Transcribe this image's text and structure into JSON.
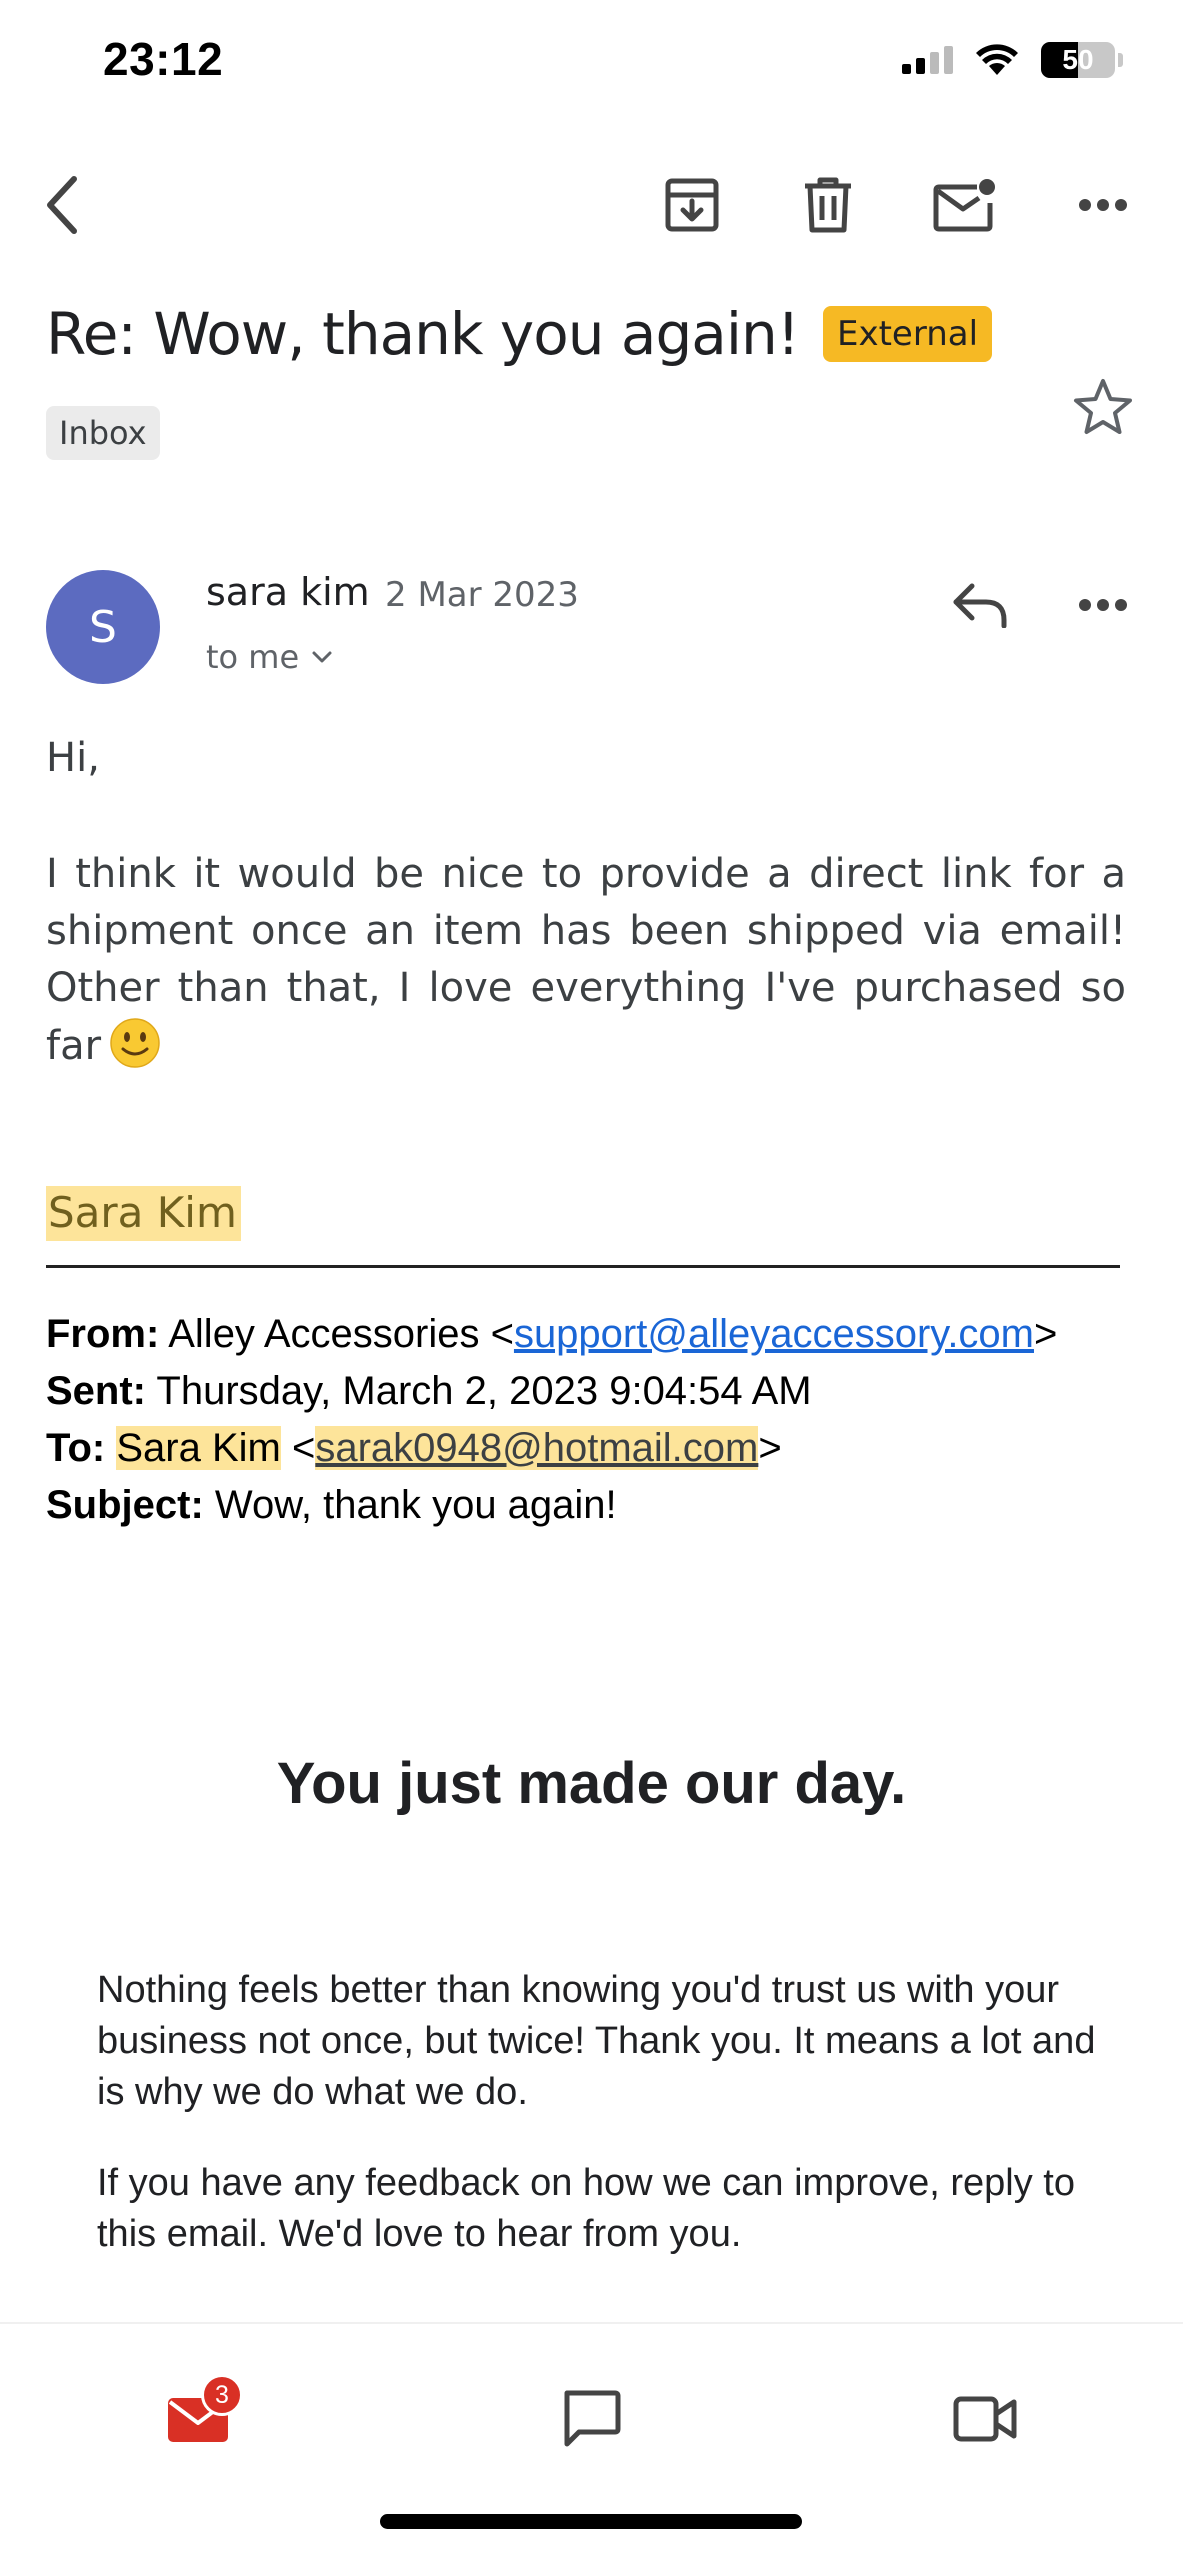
{
  "status_bar": {
    "time": "23:12",
    "battery": "50",
    "battery_level": 0.5
  },
  "toolbar": {
    "back_icon": "back-arrow-icon",
    "archive_icon": "archive-icon",
    "delete_icon": "trash-icon",
    "mark_unread_icon": "mail-unread-icon",
    "more_icon": "more-horizontal-icon"
  },
  "email": {
    "subject": "Re: Wow, thank you again!",
    "external_badge": "External",
    "label_chip": "Inbox",
    "sender": {
      "initial": "S",
      "name": "sara kim",
      "date": "2 Mar 2023",
      "to": "to me"
    },
    "greeting": "Hi,",
    "paragraph": "I think it would be nice to provide a direct link for a shipment once an item has been shipped via email! Other than that, I love everything I've purchased so far",
    "signature": "Sara Kim",
    "quoted": {
      "from_label": "From:",
      "from_name": "Alley Accessories <",
      "from_email": "support@alleyaccessory.com",
      "from_close": ">",
      "sent_label": "Sent:",
      "sent_value": "Thursday, March 2, 2023 9:04:54 AM",
      "to_label": "To:",
      "to_name": "Sara Kim",
      "to_open": " <",
      "to_email": "sarak0948@hotmail.com",
      "to_close": ">",
      "subject_label": "Subject:",
      "subject_value": "Wow, thank you again!"
    },
    "headline": "You just made our day.",
    "note_1": "Nothing feels better than knowing you'd trust us with your business not once, but twice! Thank you. It means a lot and is why we do what we do.",
    "note_2": "If you have any feedback on how we can improve, reply to this email. We'd love to hear from you."
  },
  "bottom_nav": {
    "mail_badge": "3",
    "items": [
      "mail-icon",
      "chat-icon",
      "video-icon"
    ]
  },
  "colors": {
    "accent_red": "#d93025",
    "external_badge": "#f6b924",
    "avatar": "#5c6bc0",
    "highlight": "#fde49a",
    "link": "#1a66d6"
  }
}
